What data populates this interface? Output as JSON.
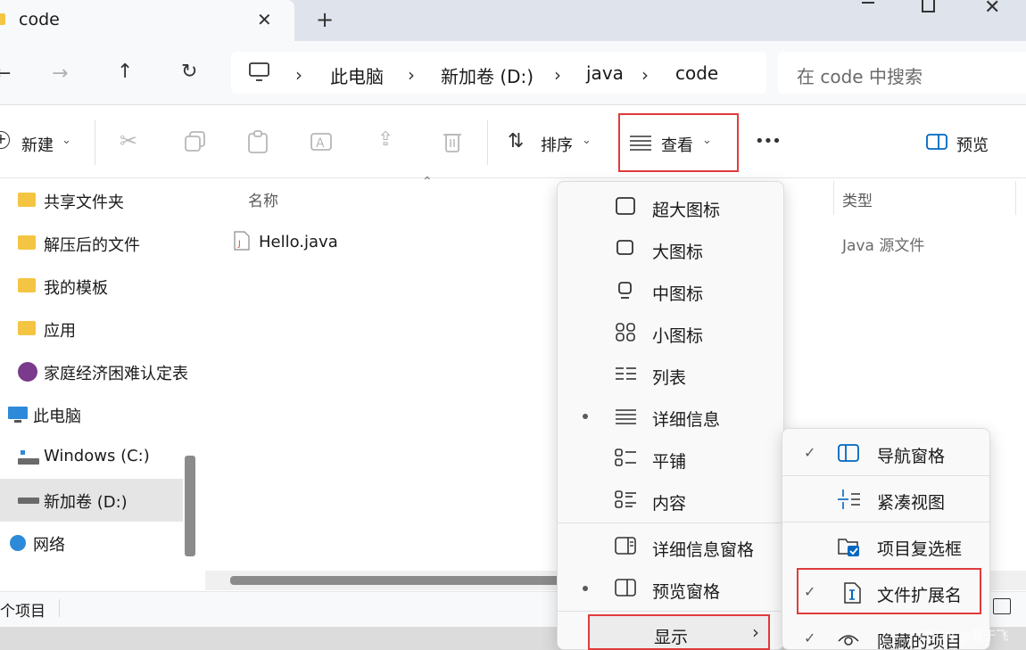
{
  "window": {
    "tab_title": "code",
    "new_tab": "+",
    "controls": {
      "minimize": "—",
      "maximize": "□",
      "close": "✕"
    }
  },
  "nav": {
    "breadcrumbs": [
      "此电脑",
      "新加卷 (D:)",
      "java",
      "code"
    ],
    "separator": "›",
    "search_placeholder": "在 code 中搜索"
  },
  "toolbar": {
    "new_label": "新建",
    "sort_label": "排序",
    "view_label": "查看",
    "more_label": "•••",
    "preview_label": "预览"
  },
  "sidebar": {
    "items": [
      {
        "label": "共享文件夹"
      },
      {
        "label": "解压后的文件"
      },
      {
        "label": "我的模板"
      },
      {
        "label": "应用"
      },
      {
        "label": "家庭经济困难认定表"
      },
      {
        "label": "此电脑"
      },
      {
        "label": "Windows  (C:)"
      },
      {
        "label": "新加卷 (D:)"
      },
      {
        "label": "网络"
      }
    ]
  },
  "filelist": {
    "columns": {
      "name": "名称",
      "type": "类型"
    },
    "files": [
      {
        "name": "Hello.java",
        "type": "Java 源文件"
      }
    ]
  },
  "status": {
    "text": "个项目"
  },
  "view_menu": {
    "items": [
      {
        "label": "超大图标"
      },
      {
        "label": "大图标"
      },
      {
        "label": "中图标"
      },
      {
        "label": "小图标"
      },
      {
        "label": "列表"
      },
      {
        "label": "详细信息"
      },
      {
        "label": "平铺"
      },
      {
        "label": "内容"
      },
      {
        "label": "详细信息窗格"
      },
      {
        "label": "预览窗格"
      },
      {
        "label": "显示"
      }
    ],
    "submenu_arrow": "›"
  },
  "show_submenu": {
    "items": [
      {
        "label": "导航窗格",
        "checked": true
      },
      {
        "label": "紧凑视图",
        "checked": false
      },
      {
        "label": "项目复选框",
        "checked": false
      },
      {
        "label": "文件扩展名",
        "checked": true
      },
      {
        "label": "隐藏的项目",
        "checked": true
      }
    ],
    "check_mark": "✓"
  },
  "watermark": "CSDN @雁于飞",
  "colors": {
    "highlight": "#e13b3b",
    "accent": "#0067c0",
    "folder": "#f4c542"
  }
}
